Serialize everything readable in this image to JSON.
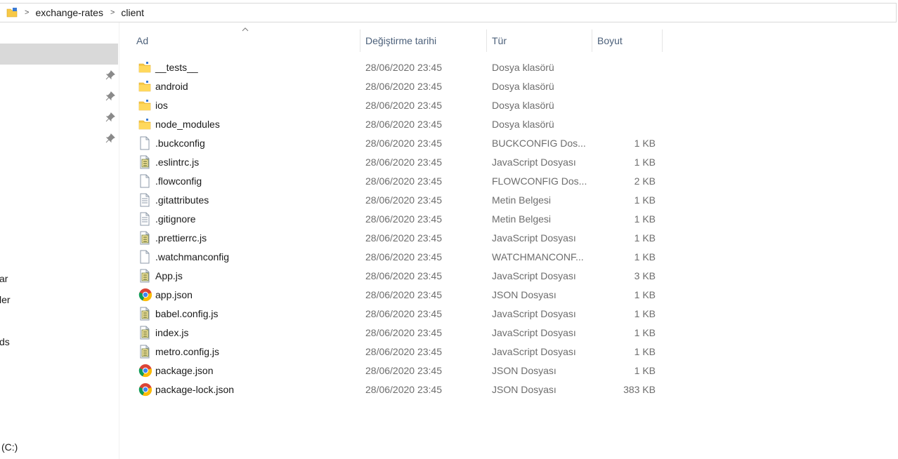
{
  "breadcrumb": [
    "exchange-rates",
    "client"
  ],
  "breadcrumb_separator": ">",
  "sidebar": {
    "partial_labels": [
      "ar",
      "ler",
      "ds",
      "(C:)"
    ]
  },
  "columns": {
    "name": "Ad",
    "date": "Değiştirme tarihi",
    "type": "Tür",
    "size": "Boyut"
  },
  "files": [
    {
      "name": "__tests__",
      "date": "28/06/2020 23:45",
      "type": "Dosya klasörü",
      "size": "",
      "icon": "folder-icon"
    },
    {
      "name": "android",
      "date": "28/06/2020 23:45",
      "type": "Dosya klasörü",
      "size": "",
      "icon": "folder-icon"
    },
    {
      "name": "ios",
      "date": "28/06/2020 23:45",
      "type": "Dosya klasörü",
      "size": "",
      "icon": "folder-icon"
    },
    {
      "name": "node_modules",
      "date": "28/06/2020 23:45",
      "type": "Dosya klasörü",
      "size": "",
      "icon": "folder-icon"
    },
    {
      "name": ".buckconfig",
      "date": "28/06/2020 23:45",
      "type": "BUCKCONFIG Dos...",
      "size": "1 KB",
      "icon": "blank-file-icon"
    },
    {
      "name": ".eslintrc.js",
      "date": "28/06/2020 23:45",
      "type": "JavaScript Dosyası",
      "size": "1 KB",
      "icon": "js-file-icon"
    },
    {
      "name": ".flowconfig",
      "date": "28/06/2020 23:45",
      "type": "FLOWCONFIG Dos...",
      "size": "2 KB",
      "icon": "blank-file-icon"
    },
    {
      "name": ".gitattributes",
      "date": "28/06/2020 23:45",
      "type": "Metin Belgesi",
      "size": "1 KB",
      "icon": "text-file-icon"
    },
    {
      "name": ".gitignore",
      "date": "28/06/2020 23:45",
      "type": "Metin Belgesi",
      "size": "1 KB",
      "icon": "text-file-icon"
    },
    {
      "name": ".prettierrc.js",
      "date": "28/06/2020 23:45",
      "type": "JavaScript Dosyası",
      "size": "1 KB",
      "icon": "js-file-icon"
    },
    {
      "name": ".watchmanconfig",
      "date": "28/06/2020 23:45",
      "type": "WATCHMANCONF...",
      "size": "1 KB",
      "icon": "blank-file-icon"
    },
    {
      "name": "App.js",
      "date": "28/06/2020 23:45",
      "type": "JavaScript Dosyası",
      "size": "3 KB",
      "icon": "js-file-icon"
    },
    {
      "name": "app.json",
      "date": "28/06/2020 23:45",
      "type": "JSON Dosyası",
      "size": "1 KB",
      "icon": "chrome-icon"
    },
    {
      "name": "babel.config.js",
      "date": "28/06/2020 23:45",
      "type": "JavaScript Dosyası",
      "size": "1 KB",
      "icon": "js-file-icon"
    },
    {
      "name": "index.js",
      "date": "28/06/2020 23:45",
      "type": "JavaScript Dosyası",
      "size": "1 KB",
      "icon": "js-file-icon"
    },
    {
      "name": "metro.config.js",
      "date": "28/06/2020 23:45",
      "type": "JavaScript Dosyası",
      "size": "1 KB",
      "icon": "js-file-icon"
    },
    {
      "name": "package.json",
      "date": "28/06/2020 23:45",
      "type": "JSON Dosyası",
      "size": "1 KB",
      "icon": "chrome-icon"
    },
    {
      "name": "package-lock.json",
      "date": "28/06/2020 23:45",
      "type": "JSON Dosyası",
      "size": "383 KB",
      "icon": "chrome-icon"
    }
  ],
  "colors": {
    "folder": "#f7c948",
    "header_text": "#4c607a",
    "selection": "#d9d9d9"
  }
}
